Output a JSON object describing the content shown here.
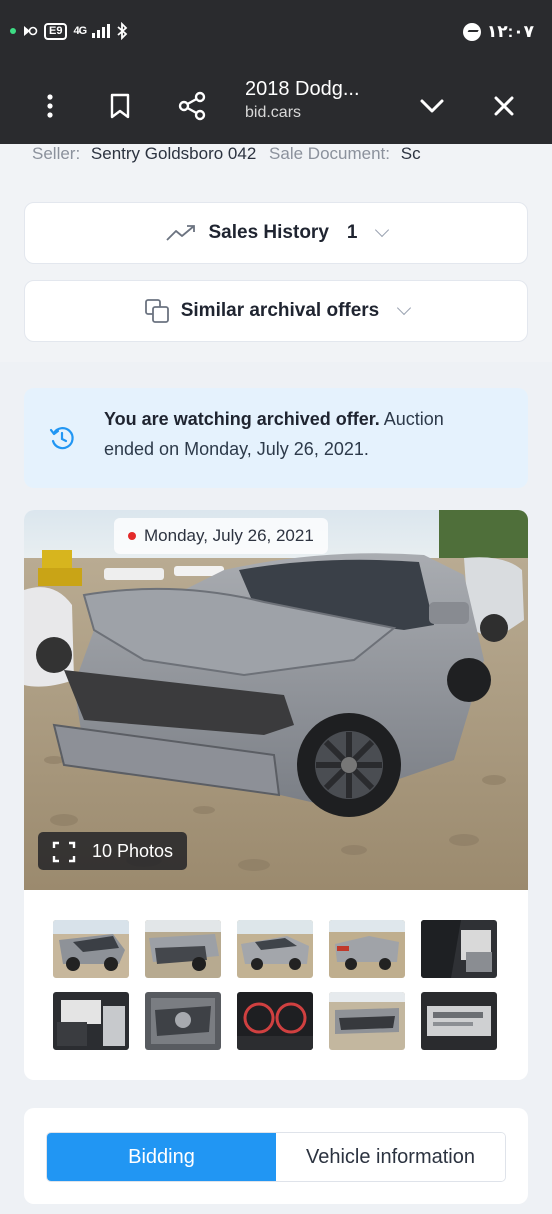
{
  "status_bar": {
    "battery": "E9",
    "network": "4G",
    "time": "١٢:٠٧"
  },
  "browser": {
    "title": "2018 Dodg...",
    "domain": "bid.cars"
  },
  "seller_line": {
    "seller_label": "Seller:",
    "seller_value": "Sentry Goldsboro 042",
    "doc_label": "Sale Document:",
    "doc_value": "Sc"
  },
  "sales_history": {
    "label": "Sales History",
    "count": "1"
  },
  "similar_offers": {
    "label": "Similar archival offers"
  },
  "notice": {
    "bold": "You are watching archived offer.",
    "rest": " Auction ended on Monday, July 26, 2021."
  },
  "gallery": {
    "date": "Monday, July 26, 2021",
    "photos_label": "10 Photos"
  },
  "tabs": {
    "bidding": "Bidding",
    "vehicle_info": "Vehicle information"
  },
  "colors": {
    "accent": "#2196f3",
    "notice_bg": "#e5f2fd",
    "status_bar": "#2a2b2e"
  }
}
